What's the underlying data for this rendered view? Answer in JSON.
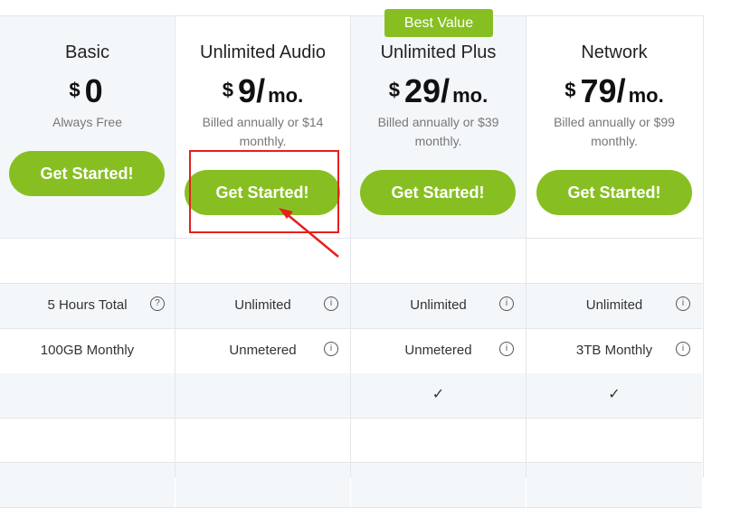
{
  "badge": "Best Value",
  "plans": [
    {
      "name": "Basic",
      "currency": "$",
      "amount": "0",
      "period": "",
      "subtitle": "Always Free",
      "button": "Get Started!"
    },
    {
      "name": "Unlimited Audio",
      "currency": "$",
      "amount": "9/",
      "period": "mo.",
      "subtitle": "Billed annually or $14 monthly.",
      "button": "Get Started!"
    },
    {
      "name": "Unlimited Plus",
      "currency": "$",
      "amount": "29/",
      "period": "mo.",
      "subtitle": "Billed annually or $39 monthly.",
      "button": "Get Started!"
    },
    {
      "name": "Network",
      "currency": "$",
      "amount": "79/",
      "period": "mo.",
      "subtitle": "Billed annually or $99 monthly.",
      "button": "Get Started!"
    }
  ],
  "features": {
    "row_time": [
      "5 Hours Total",
      "Unlimited",
      "Unlimited",
      "Unlimited"
    ],
    "row_bandwidth": [
      "100GB Monthly",
      "Unmetered",
      "Unmetered",
      "3TB Monthly"
    ],
    "row_check": [
      "",
      "",
      "✓",
      "✓"
    ]
  },
  "icons": {
    "info": "i",
    "help": "?",
    "check": "✓"
  },
  "colors": {
    "accent": "#87bf23",
    "highlight": "#e5201e",
    "shaded": "#f4f7fa"
  }
}
